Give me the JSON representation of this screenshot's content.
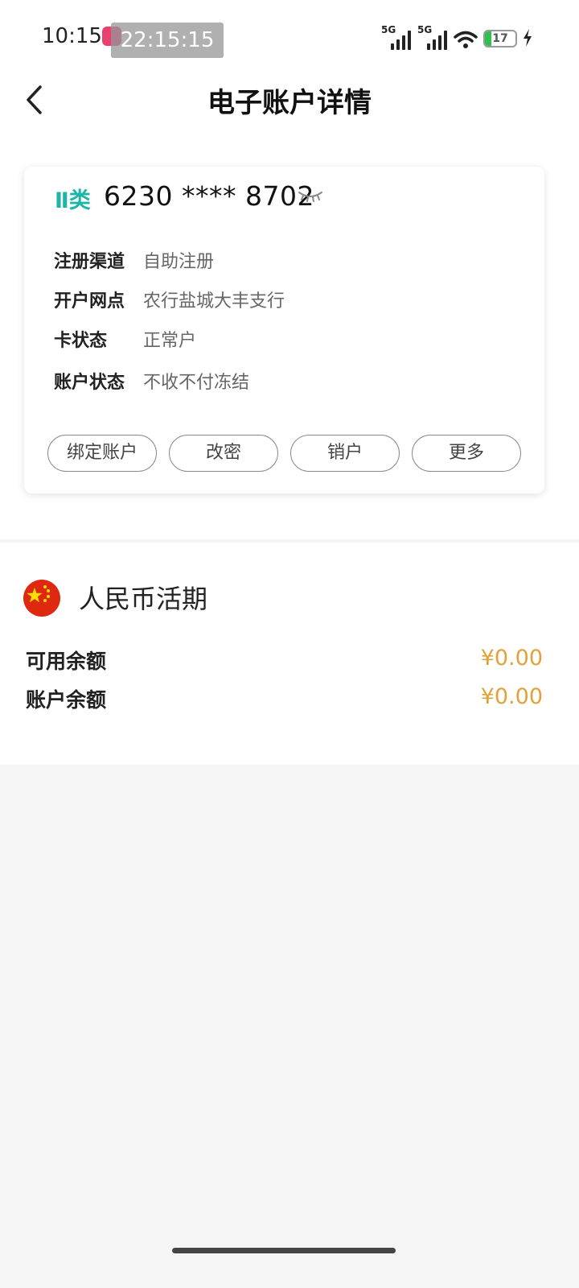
{
  "status_bar": {
    "time": "10:15",
    "overlay_time": "22:15:15",
    "network_1": "5G",
    "network_2": "5G",
    "battery": "17"
  },
  "header": {
    "title": "电子账户详情"
  },
  "card": {
    "type_badge": "Ⅱ类",
    "number": "6230 **** 8702",
    "info": [
      {
        "label": "注册渠道",
        "value": "自助注册"
      },
      {
        "label": "开户网点",
        "value": "农行盐城大丰支行"
      },
      {
        "label": "卡状态",
        "value": "正常户"
      },
      {
        "label": "账户状态",
        "value": "不收不付冻结"
      }
    ],
    "actions": [
      "绑定账户",
      "改密",
      "销户",
      "更多"
    ]
  },
  "balance": {
    "currency_title": "人民币活期",
    "rows": [
      {
        "label": "可用余额",
        "value": "¥0.00"
      },
      {
        "label": "账户余额",
        "value": "¥0.00"
      }
    ]
  },
  "colors": {
    "accent_teal": "#1fb5a6",
    "amount_gold": "#e0a23a",
    "battery_green": "#2ec24a",
    "flag_red": "#de2910",
    "flag_yellow": "#ffde00"
  }
}
